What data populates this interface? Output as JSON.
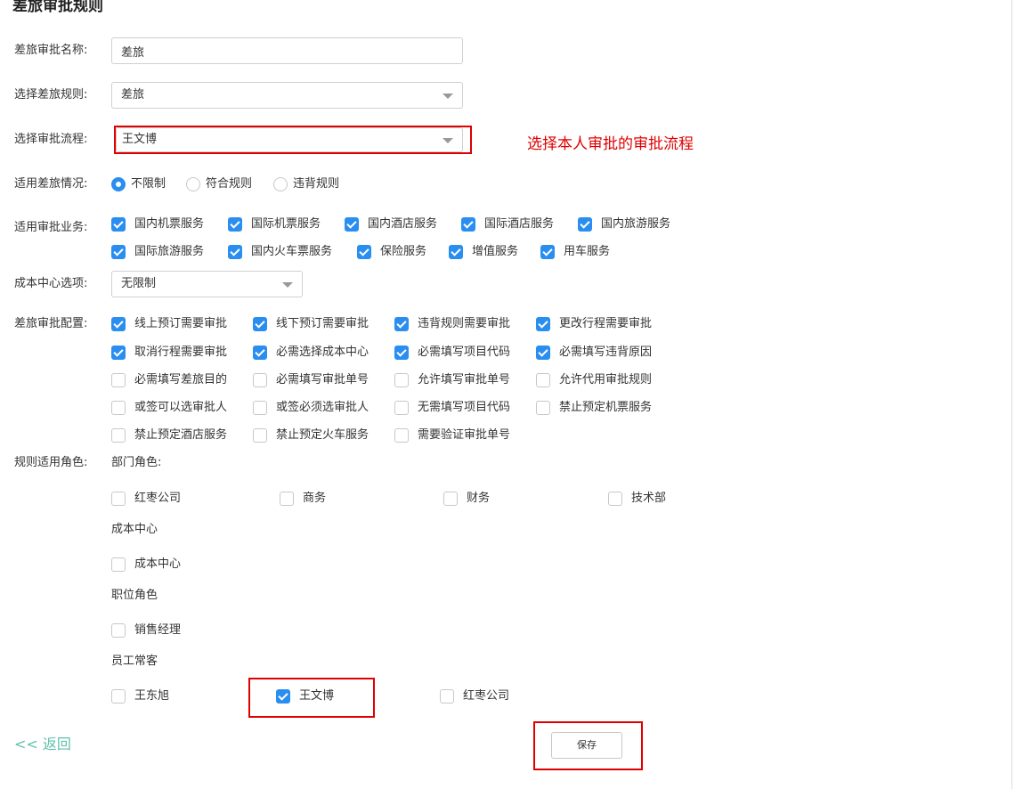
{
  "page": {
    "title": "差旅审批规则"
  },
  "form": {
    "name": {
      "label": "差旅审批名称:",
      "value": "差旅"
    },
    "rule": {
      "label": "选择差旅规则:",
      "value": "差旅"
    },
    "flow": {
      "label": "选择审批流程:",
      "value": "王文博"
    },
    "annotation": "选择本人审批的审批流程",
    "situation": {
      "label": "适用差旅情况:",
      "options": [
        "不限制",
        "符合规则",
        "违背规则"
      ],
      "selected": "不限制"
    },
    "business": {
      "label": "适用审批业务:",
      "items": [
        {
          "label": "国内机票服务",
          "checked": true
        },
        {
          "label": "国际机票服务",
          "checked": true
        },
        {
          "label": "国内酒店服务",
          "checked": true
        },
        {
          "label": "国际酒店服务",
          "checked": true
        },
        {
          "label": "国内旅游服务",
          "checked": true
        },
        {
          "label": "国际旅游服务",
          "checked": true
        },
        {
          "label": "国内火车票服务",
          "checked": true
        },
        {
          "label": "保险服务",
          "checked": true
        },
        {
          "label": "增值服务",
          "checked": true
        },
        {
          "label": "用车服务",
          "checked": true
        }
      ]
    },
    "cost_center": {
      "label": "成本中心选项:",
      "value": "无限制"
    },
    "config": {
      "label": "差旅审批配置:",
      "items": [
        {
          "label": "线上预订需要审批",
          "checked": true
        },
        {
          "label": "线下预订需要审批",
          "checked": true
        },
        {
          "label": "违背规则需要审批",
          "checked": true
        },
        {
          "label": "更改行程需要审批",
          "checked": true
        },
        {
          "label": "取消行程需要审批",
          "checked": true
        },
        {
          "label": "必需选择成本中心",
          "checked": true
        },
        {
          "label": "必需填写项目代码",
          "checked": true
        },
        {
          "label": "必需填写违背原因",
          "checked": true
        },
        {
          "label": "必需填写差旅目的",
          "checked": false
        },
        {
          "label": "必需填写审批单号",
          "checked": false
        },
        {
          "label": "允许填写审批单号",
          "checked": false
        },
        {
          "label": "允许代用审批规则",
          "checked": false
        },
        {
          "label": "或签可以选审批人",
          "checked": false
        },
        {
          "label": "或签必须选审批人",
          "checked": false
        },
        {
          "label": "无需填写项目代码",
          "checked": false
        },
        {
          "label": "禁止预定机票服务",
          "checked": false
        },
        {
          "label": "禁止预定酒店服务",
          "checked": false
        },
        {
          "label": "禁止预定火车服务",
          "checked": false
        },
        {
          "label": "需要验证审批单号",
          "checked": false
        }
      ]
    },
    "roles": {
      "label": "规则适用角色:",
      "dept": {
        "title": "部门角色:",
        "items": [
          {
            "label": "红枣公司",
            "checked": false
          },
          {
            "label": "商务",
            "checked": false
          },
          {
            "label": "财务",
            "checked": false
          },
          {
            "label": "技术部",
            "checked": false
          }
        ]
      },
      "cost": {
        "title": "成本中心",
        "items": [
          {
            "label": "成本中心",
            "checked": false
          }
        ]
      },
      "position": {
        "title": "职位角色",
        "items": [
          {
            "label": "销售经理",
            "checked": false
          }
        ]
      },
      "frequent": {
        "title": "员工常客",
        "items": [
          {
            "label": "王东旭",
            "checked": false
          },
          {
            "label": "王文博",
            "checked": true
          },
          {
            "label": "红枣公司",
            "checked": false
          }
        ]
      }
    }
  },
  "footer": {
    "back_label": "<< 返回",
    "save_label": "保存"
  },
  "colors": {
    "accent": "#2a8ef0",
    "annotation_red": "#e00000",
    "back_link": "#5fc1a9"
  }
}
